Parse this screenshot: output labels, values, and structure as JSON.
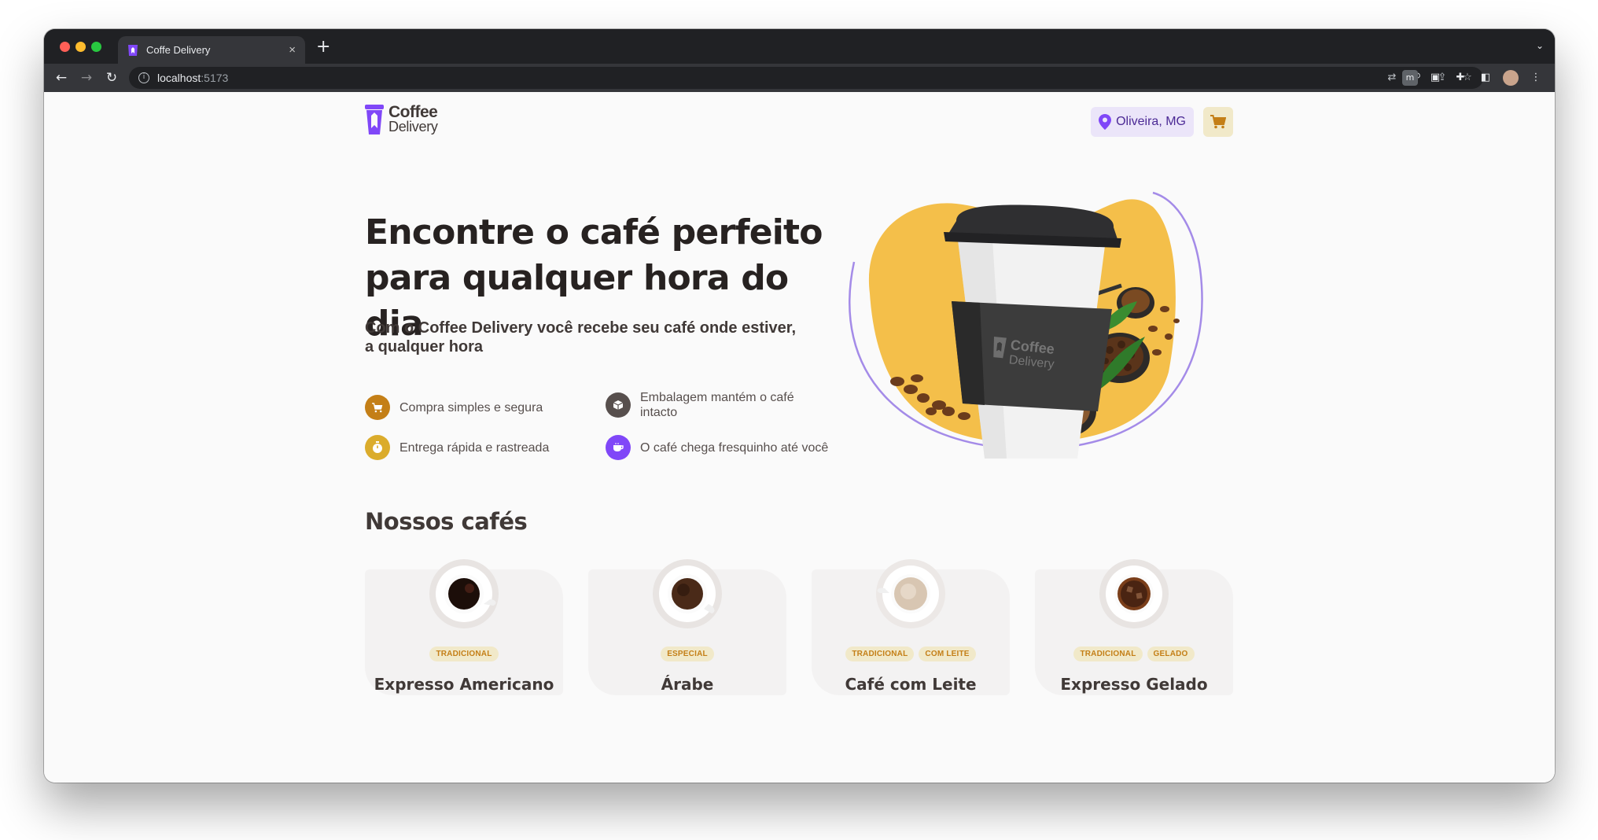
{
  "browser": {
    "tab_title": "Coffe Delivery",
    "url_host": "localhost",
    "url_port": ":5173",
    "new_tab": "+",
    "close_tab": "×"
  },
  "header": {
    "logo_line1": "Coffee",
    "logo_line2": "Delivery",
    "location": "Oliveira, MG"
  },
  "hero": {
    "title": "Encontre o café perfeito para qualquer hora do dia",
    "subtitle": "Com o Coffee Delivery você recebe seu café onde estiver, a qualquer hora",
    "features": [
      {
        "label": "Compra simples e segura",
        "icon": "cart-icon",
        "color": "#c47f17"
      },
      {
        "label": "Embalagem mantém o café intacto",
        "icon": "package-icon",
        "color": "#574f4d"
      },
      {
        "label": "Entrega rápida e rastreada",
        "icon": "timer-icon",
        "color": "#dbac2c"
      },
      {
        "label": "O café chega fresquinho até você",
        "icon": "coffee-icon",
        "color": "#8047f8"
      }
    ],
    "cup_logo_line1": "Coffee",
    "cup_logo_line2": "Delivery"
  },
  "catalog": {
    "title": "Nossos cafés",
    "items": [
      {
        "name": "Expresso Americano",
        "tags": [
          "TRADICIONAL"
        ]
      },
      {
        "name": "Árabe",
        "tags": [
          "ESPECIAL"
        ]
      },
      {
        "name": "Café com Leite",
        "tags": [
          "TRADICIONAL",
          "COM LEITE"
        ]
      },
      {
        "name": "Expresso Gelado",
        "tags": [
          "TRADICIONAL",
          "GELADO"
        ]
      }
    ]
  },
  "colors": {
    "purple": "#8047f8",
    "purple_dark": "#4b2995",
    "purple_light": "#ebe5f9",
    "yellow": "#dbac2c",
    "yellow_dark": "#c47f17",
    "yellow_light": "#f1e9c9",
    "background": "#fafafa"
  }
}
